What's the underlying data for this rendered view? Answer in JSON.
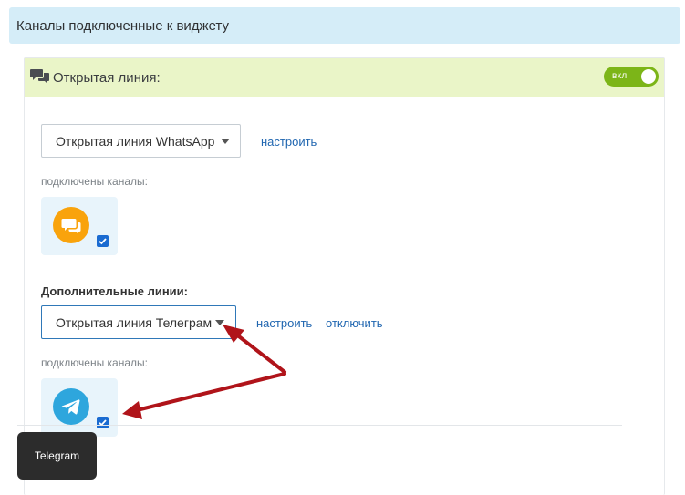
{
  "panel": {
    "title": "Каналы подключенные к виджету"
  },
  "open_line": {
    "title": "Открытая линия:",
    "toggle_label": "вкл",
    "select_value": "Открытая линия WhatsApp",
    "configure_link": "настроить",
    "connected_label": "подключены каналы:",
    "channel_icon": "chat-bubbles-icon",
    "channel_checked": true
  },
  "additional_lines": {
    "title": "Дополнительные линии:",
    "select_value": "Открытая линия Телеграм",
    "configure_link": "настроить",
    "disconnect_link": "отключить",
    "connected_label": "подключены каналы:",
    "channel_icon": "telegram-icon",
    "channel_checked": true
  },
  "tooltip": {
    "text": "Telegram"
  },
  "colors": {
    "header_bg": "#d5edf8",
    "section_head_bg": "#eaf5c8",
    "toggle_on": "#7cb518",
    "link": "#2066b0",
    "chat_channel": "#f9a30c",
    "telegram": "#2ea6dd",
    "annotation_arrow": "#b0141a"
  }
}
